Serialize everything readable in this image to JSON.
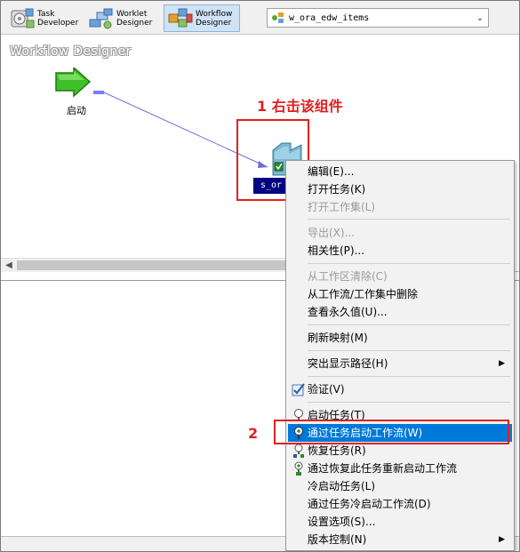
{
  "toolbar": {
    "task_developer": "Task\nDeveloper",
    "worklet_designer": "Worklet\nDesigner",
    "workflow_designer": "Workflow\nDesigner",
    "workflow_combo_value": "w_ora_edw_items"
  },
  "workspace": {
    "title": "Workflow Designer",
    "start_label": "启动",
    "session_label": "s_or"
  },
  "annotations": {
    "step1": "1 右击该组件",
    "step2": "2"
  },
  "context_menu": {
    "items": [
      {
        "label": "编辑(E)...",
        "enabled": true
      },
      {
        "label": "打开任务(K)",
        "enabled": true
      },
      {
        "label": "打开工作集(L)",
        "enabled": false
      },
      {
        "label": "导出(X)...",
        "enabled": false
      },
      {
        "label": "相关性(P)...",
        "enabled": true
      },
      {
        "label": "从工作区清除(C)",
        "enabled": false
      },
      {
        "label": "从工作流/工作集中删除",
        "enabled": true
      },
      {
        "label": "查看永久值(U)...",
        "enabled": true
      },
      {
        "label": "刷新映射(M)",
        "enabled": true
      },
      {
        "label": "突出显示路径(H)",
        "enabled": true
      },
      {
        "label": "验证(V)",
        "enabled": true
      },
      {
        "label": "启动任务(T)",
        "enabled": true
      },
      {
        "label": "通过任务启动工作流(W)",
        "enabled": true
      },
      {
        "label": "恢复任务(R)",
        "enabled": true
      },
      {
        "label": "通过恢复此任务重新启动工作流",
        "enabled": true
      },
      {
        "label": "冷启动任务(L)",
        "enabled": true
      },
      {
        "label": "通过任务冷启动工作流(D)",
        "enabled": true
      },
      {
        "label": "设置选项(S)...",
        "enabled": true
      },
      {
        "label": "版本控制(N)",
        "enabled": true
      }
    ]
  },
  "colors": {
    "highlight": "#0078d7",
    "annotation": "#e02020",
    "session_label_bg": "#000080"
  },
  "icons": [
    "task-developer-icon",
    "worklet-designer-icon",
    "workflow-designer-icon",
    "workflow-icon",
    "start-arrow-icon",
    "session-icon",
    "validate-icon",
    "start-task-icon",
    "start-workflow-icon",
    "recover-task-icon",
    "restart-workflow-icon",
    "submenu-arrow-icon",
    "dropdown-arrow-icon"
  ]
}
